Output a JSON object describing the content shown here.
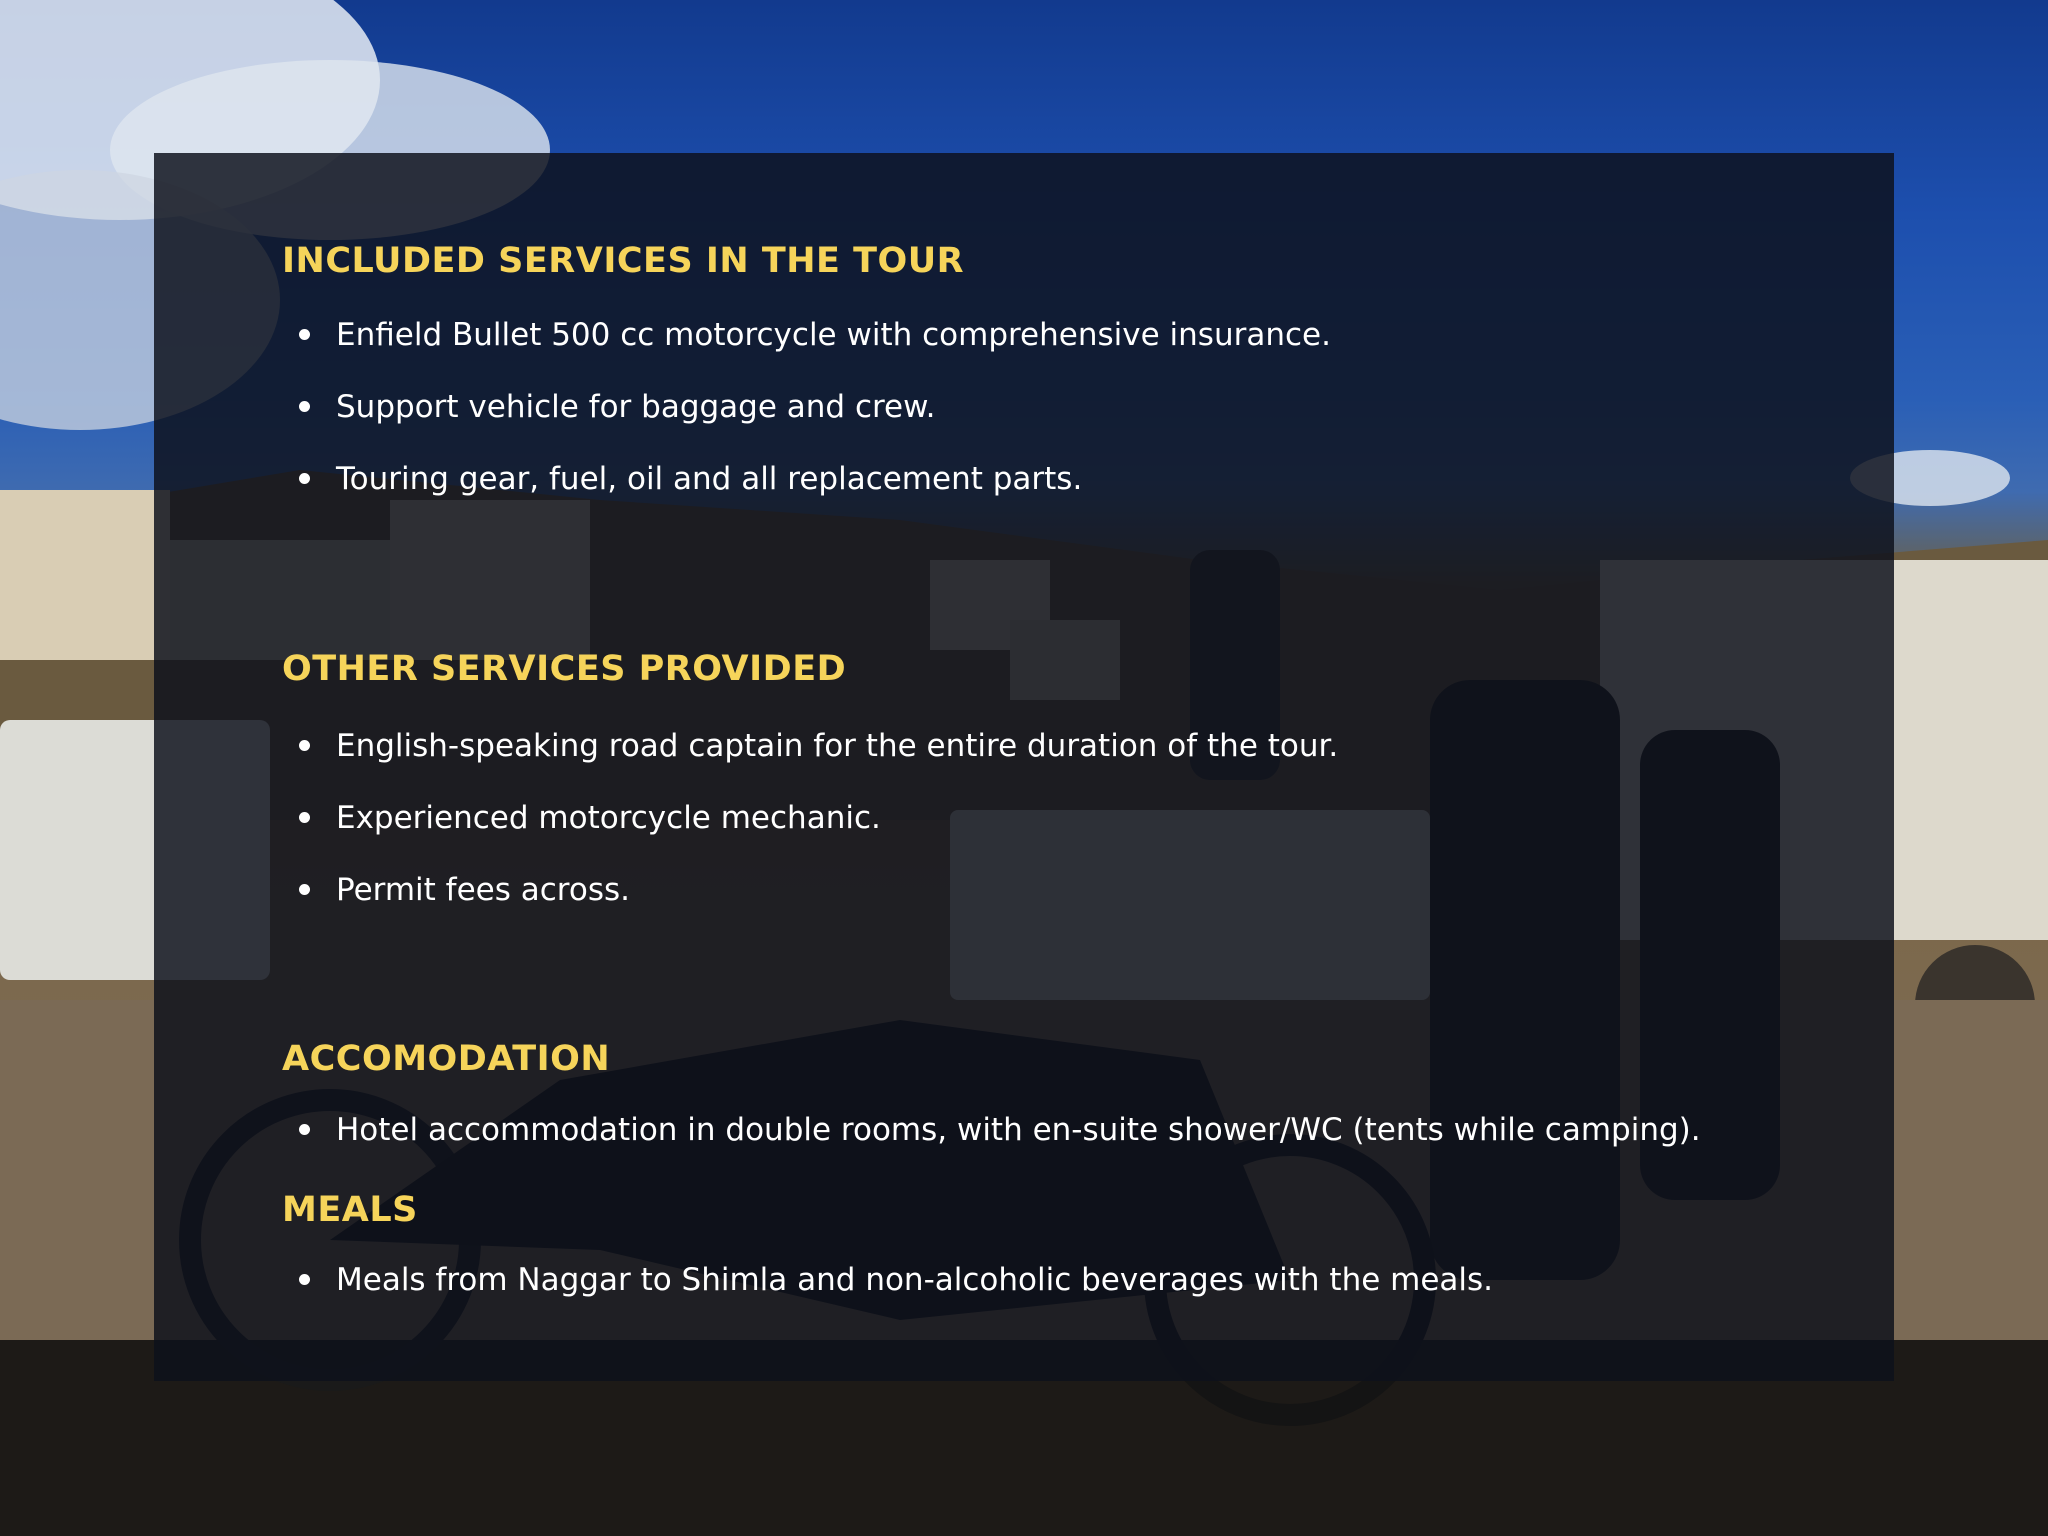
{
  "sections": [
    {
      "title": "INCLUDED SERVICES IN THE TOUR",
      "items": [
        "Enfield Bullet 500 cc motorcycle with comprehensive insurance.",
        "Support vehicle for baggage and crew.",
        "Touring gear, fuel, oil and all replacement parts."
      ]
    },
    {
      "title": "OTHER SERVICES PROVIDED",
      "items": [
        "English-speaking road captain for the entire duration of the tour.",
        "Experienced motorcycle mechanic.",
        "Permit fees across."
      ]
    },
    {
      "title": "ACCOMODATION",
      "items": [
        "Hotel accommodation in double rooms, with en-suite shower/WC (tents while camping)."
      ]
    },
    {
      "title": "MEALS",
      "items": [
        "Meals from Naggar to Shimla and non-alcoholic beverages with the meals."
      ]
    }
  ],
  "colors": {
    "heading": "#f6d45a",
    "text": "#ffffff",
    "panel": "#0d111c"
  }
}
